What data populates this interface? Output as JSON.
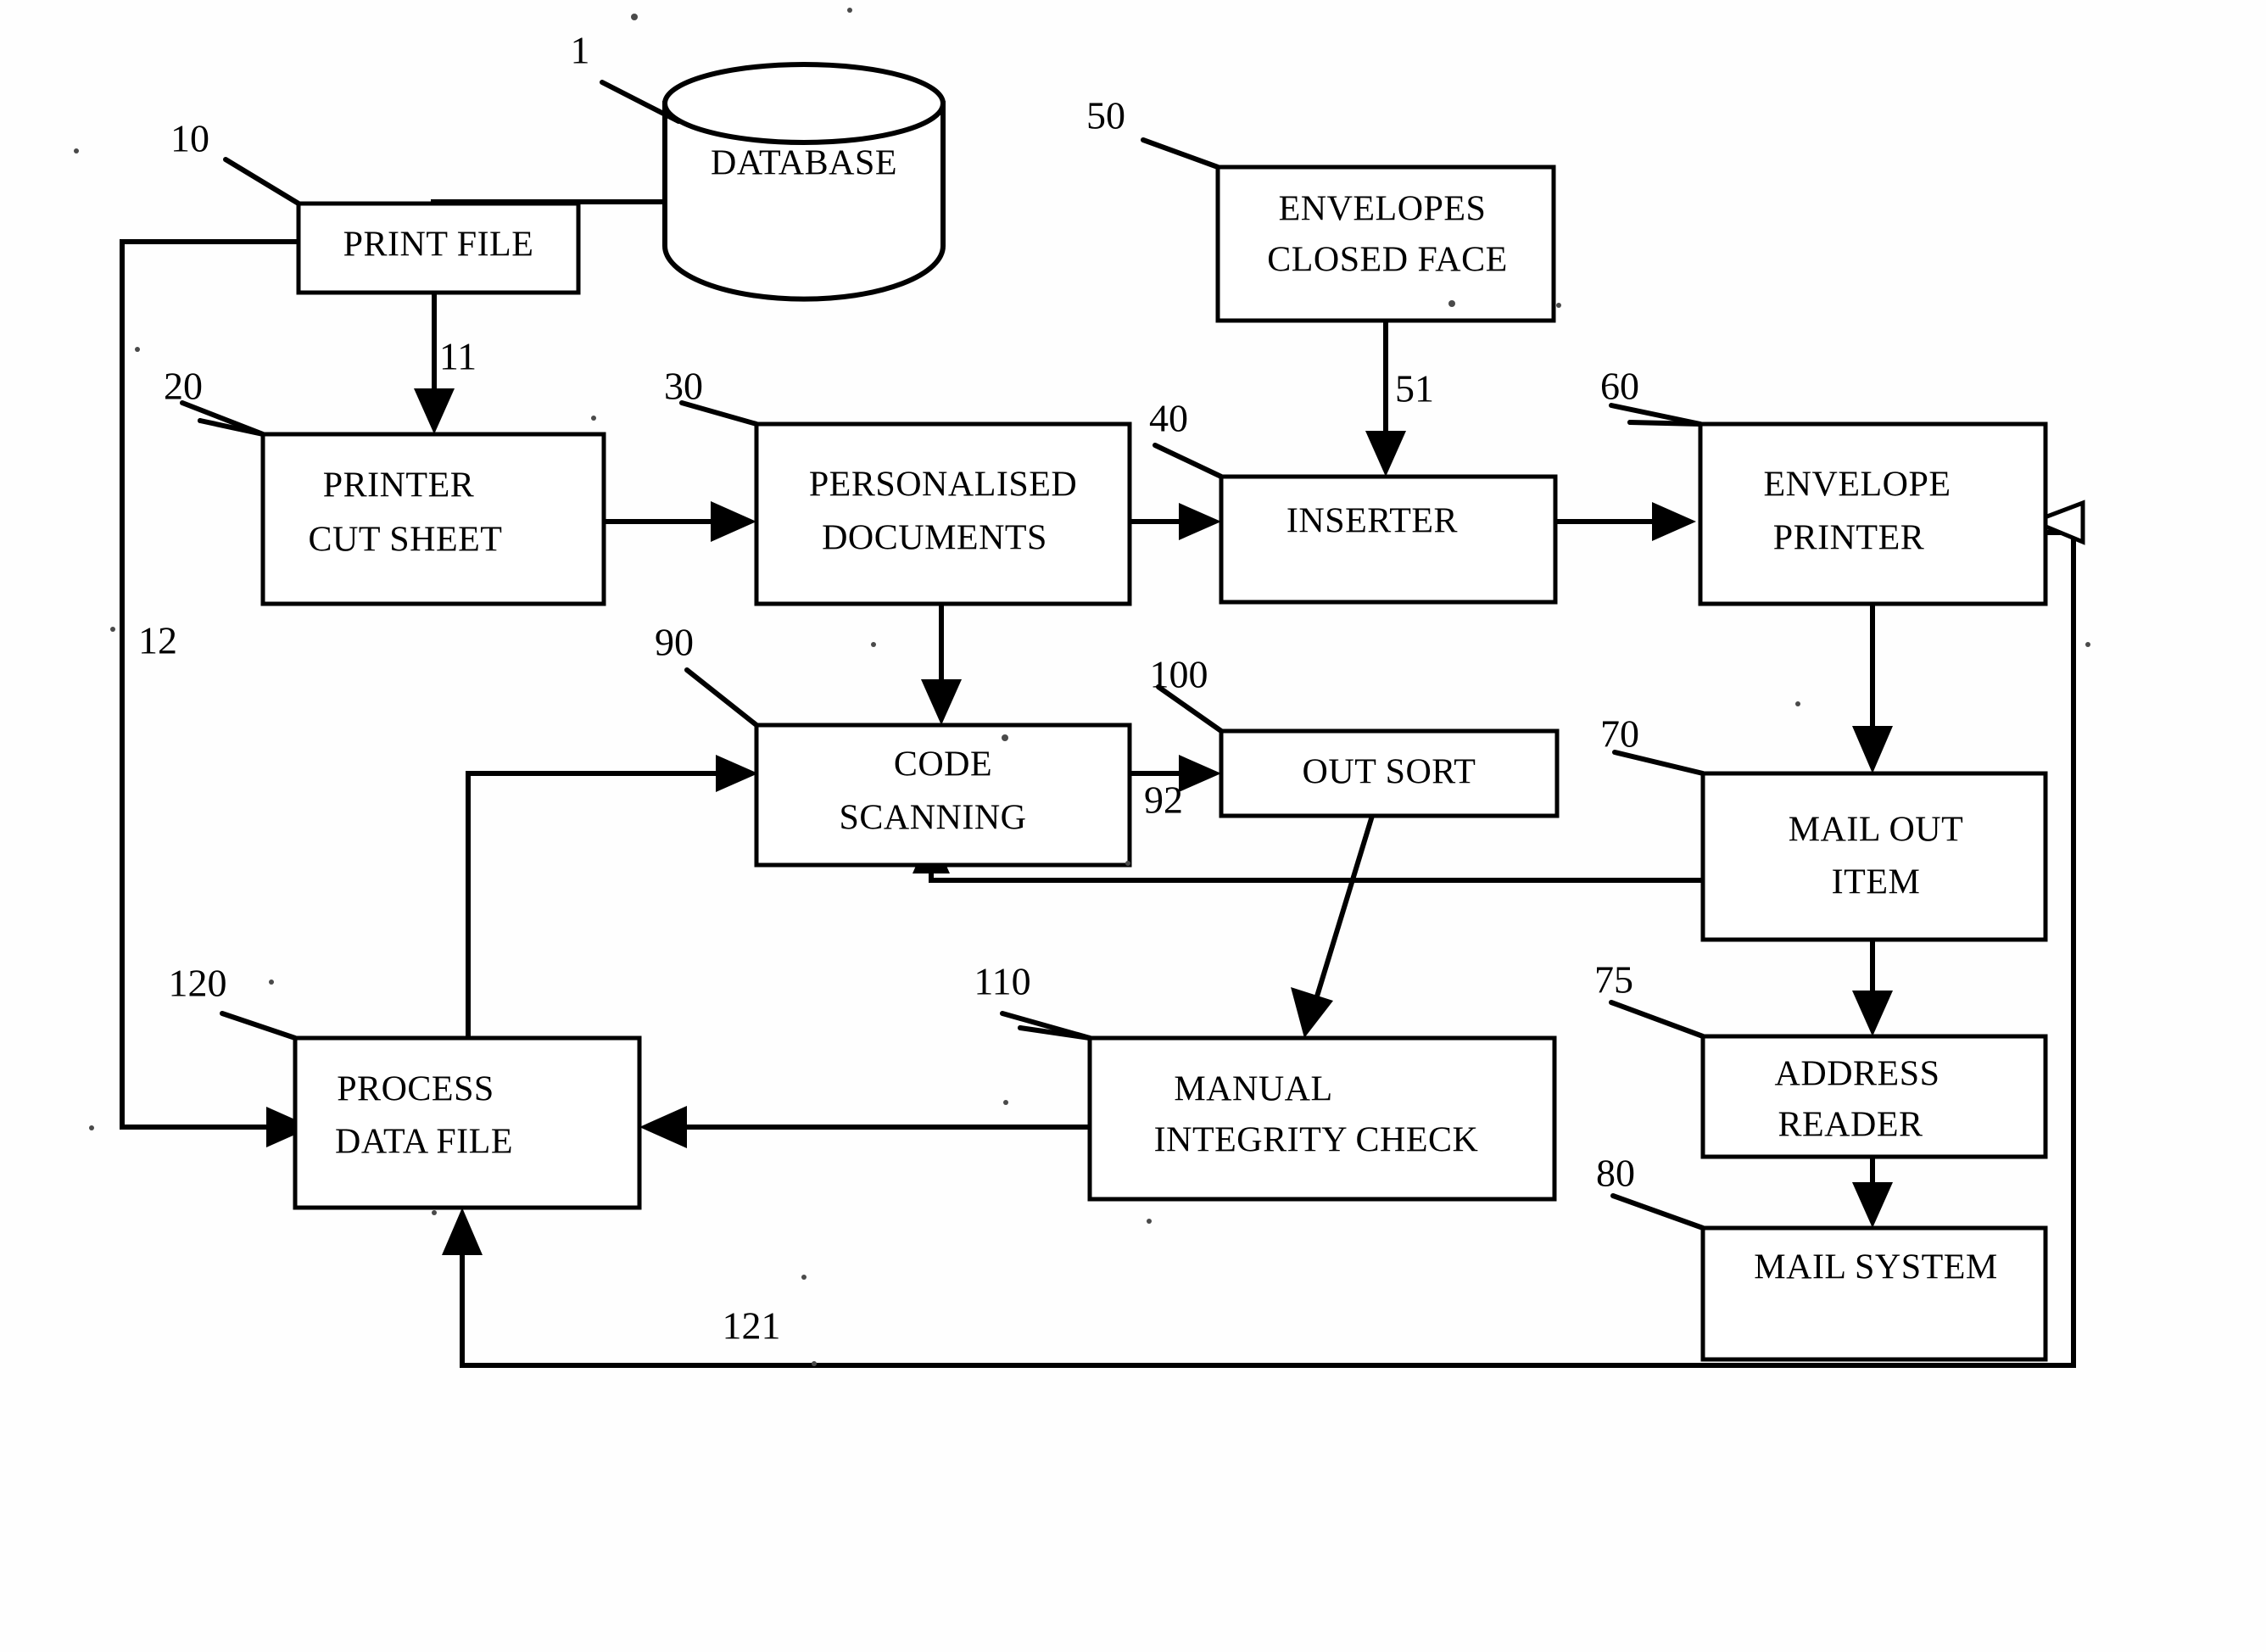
{
  "figure": {
    "type": "patent-flowchart",
    "title": "Mail production and integrity flow diagram"
  },
  "nodes": [
    {
      "id": "database",
      "ref": "1",
      "shape": "cylinder",
      "lines": [
        "DATABASE"
      ]
    },
    {
      "id": "print_file",
      "ref": "10",
      "shape": "rect",
      "lines": [
        "PRINT FILE"
      ]
    },
    {
      "id": "printer_cut_sheet",
      "ref": "20",
      "shape": "rect",
      "lines": [
        "PRINTER",
        "CUT SHEET"
      ]
    },
    {
      "id": "personalised_documents",
      "ref": "30",
      "shape": "rect",
      "lines": [
        "PERSONALISED",
        "DOCUMENTS"
      ]
    },
    {
      "id": "inserter",
      "ref": "40",
      "shape": "rect",
      "lines": [
        "INSERTER"
      ]
    },
    {
      "id": "envelopes_closed_face",
      "ref": "50",
      "shape": "rect",
      "lines": [
        "ENVELOPES",
        "CLOSED FACE"
      ]
    },
    {
      "id": "envelope_printer",
      "ref": "60",
      "shape": "rect",
      "lines": [
        "ENVELOPE",
        "PRINTER"
      ]
    },
    {
      "id": "mail_out_item",
      "ref": "70",
      "shape": "rect",
      "lines": [
        "MAIL OUT",
        "ITEM"
      ]
    },
    {
      "id": "address_reader",
      "ref": "75",
      "shape": "rect",
      "lines": [
        "ADDRESS",
        "READER"
      ]
    },
    {
      "id": "mail_system",
      "ref": "80",
      "shape": "rect",
      "lines": [
        "MAIL SYSTEM"
      ]
    },
    {
      "id": "code_scanning",
      "ref": "90",
      "shape": "rect",
      "lines": [
        "CODE",
        "SCANNING"
      ]
    },
    {
      "id": "out_sort",
      "ref": "100",
      "shape": "rect",
      "lines": [
        "OUT SORT"
      ]
    },
    {
      "id": "manual_integrity_check",
      "ref": "110",
      "shape": "rect",
      "lines": [
        "MANUAL",
        "INTEGRITY CHECK"
      ]
    },
    {
      "id": "process_data_file",
      "ref": "120",
      "shape": "rect",
      "lines": [
        "PROCESS",
        "DATA FILE"
      ]
    }
  ],
  "labels": {
    "database": "DATABASE",
    "print_file": "PRINT FILE",
    "printer_cut_sheet_1": "PRINTER",
    "printer_cut_sheet_2": "CUT SHEET",
    "personalised_documents_1": "PERSONALISED",
    "personalised_documents_2": "DOCUMENTS",
    "inserter": "INSERTER",
    "envelopes_closed_face_1": "ENVELOPES",
    "envelopes_closed_face_2": "CLOSED FACE",
    "envelope_printer_1": "ENVELOPE",
    "envelope_printer_2": "PRINTER",
    "mail_out_item_1": "MAIL OUT",
    "mail_out_item_2": "ITEM",
    "address_reader_1": "ADDRESS",
    "address_reader_2": "READER",
    "mail_system": "MAIL SYSTEM",
    "code_scanning_1": "CODE",
    "code_scanning_2": "SCANNING",
    "out_sort": "OUT SORT",
    "manual_integrity_check_1": "MANUAL",
    "manual_integrity_check_2": "INTEGRITY CHECK",
    "process_data_file_1": "PROCESS",
    "process_data_file_2": "DATA FILE"
  },
  "reference_numerals": {
    "n1": "1",
    "n10": "10",
    "n11": "11",
    "n12": "12",
    "n20": "20",
    "n30": "30",
    "n40": "40",
    "n50": "50",
    "n51": "51",
    "n60": "60",
    "n70": "70",
    "n75": "75",
    "n80": "80",
    "n90": "90",
    "n92": "92",
    "n100": "100",
    "n110": "110",
    "n120": "120",
    "n121": "121"
  },
  "edges": [
    {
      "id": "database-to-print-file",
      "from": "database",
      "to": "print_file",
      "arrow": "filled"
    },
    {
      "id": "print-file-to-printer",
      "from": "print_file",
      "to": "printer_cut_sheet",
      "ref": "11",
      "arrow": "filled"
    },
    {
      "id": "printer-to-personalised",
      "from": "printer_cut_sheet",
      "to": "personalised_documents",
      "arrow": "filled"
    },
    {
      "id": "personalised-to-inserter",
      "from": "personalised_documents",
      "to": "inserter",
      "arrow": "filled"
    },
    {
      "id": "envelopes-to-inserter",
      "from": "envelopes_closed_face",
      "to": "inserter",
      "ref": "51",
      "arrow": "filled"
    },
    {
      "id": "inserter-to-envelope-printer",
      "from": "inserter",
      "to": "envelope_printer",
      "arrow": "filled"
    },
    {
      "id": "envelope-printer-to-mail-out",
      "from": "envelope_printer",
      "to": "mail_out_item",
      "arrow": "filled"
    },
    {
      "id": "mail-out-to-address-reader",
      "from": "mail_out_item",
      "to": "address_reader",
      "arrow": "filled"
    },
    {
      "id": "address-reader-to-mail-system",
      "from": "address_reader",
      "to": "mail_system",
      "arrow": "filled"
    },
    {
      "id": "personalised-to-code-scanning",
      "from": "personalised_documents",
      "to": "code_scanning",
      "arrow": "filled"
    },
    {
      "id": "code-scanning-to-out-sort",
      "from": "code_scanning",
      "to": "out_sort",
      "ref": "92",
      "arrow": "filled"
    },
    {
      "id": "out-sort-to-manual-check",
      "from": "out_sort",
      "to": "manual_integrity_check",
      "arrow": "filled"
    },
    {
      "id": "manual-check-to-process",
      "from": "manual_integrity_check",
      "to": "process_data_file",
      "arrow": "filled"
    },
    {
      "id": "mail-out-to-code-scanning",
      "from": "mail_out_item",
      "to": "code_scanning",
      "arrow": "filled"
    },
    {
      "id": "code-branch-to-process",
      "from": "code_scanning",
      "to": "process_data_file",
      "arrow": "filled"
    },
    {
      "id": "print-file-to-process",
      "from": "print_file",
      "to": "process_data_file",
      "ref": "12",
      "arrow": "filled"
    },
    {
      "id": "process-to-envelope-printer",
      "from": "process_data_file",
      "to": "envelope_printer",
      "ref": "121",
      "arrow": "hollow"
    }
  ],
  "colors": {
    "ink": "#000000",
    "paper": "#ffffff"
  }
}
